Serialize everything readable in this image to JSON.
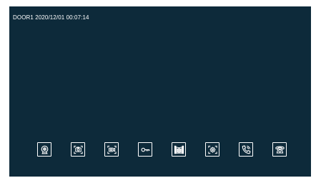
{
  "status_bar": {
    "text": "DOOR1 2020/12/01 00:07:14"
  },
  "toolbar": {
    "buttons": [
      {
        "name": "monitor",
        "icon": "camera-icon"
      },
      {
        "name": "snapshot",
        "icon": "snapshot-icon"
      },
      {
        "name": "record",
        "icon": "record-icon"
      },
      {
        "name": "unlock",
        "icon": "key-icon"
      },
      {
        "name": "gate",
        "icon": "gate-icon"
      },
      {
        "name": "settings",
        "icon": "settings-icon"
      },
      {
        "name": "answer",
        "icon": "phone-icon"
      },
      {
        "name": "intercom",
        "icon": "intercom-phone-icon"
      }
    ]
  },
  "colors": {
    "screen_background": "#0d2a3a",
    "foreground": "#ffffff"
  }
}
